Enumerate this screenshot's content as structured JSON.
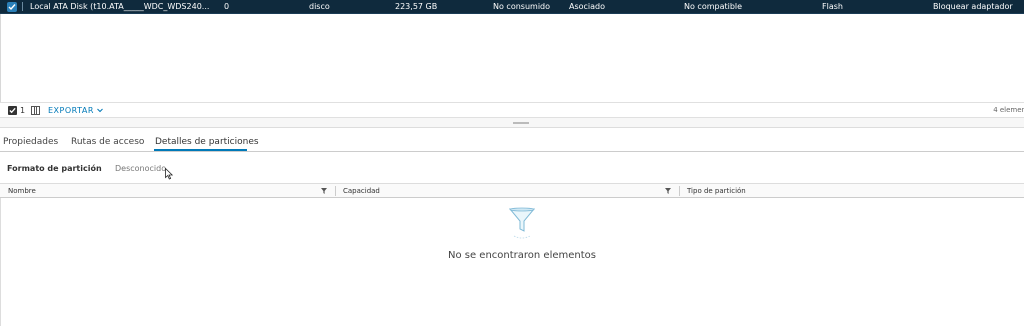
{
  "selected_row": {
    "name": "Local ATA Disk (t10.ATA_____WDC_WDS240...",
    "lun": "0",
    "type": "disco",
    "capacity": "223,57 GB",
    "datastore": "No consumido",
    "operational_state": "Asociado",
    "hardware_acceleration": "No compatible",
    "drive_type": "Flash",
    "action": "Bloquear adaptador"
  },
  "footer": {
    "selected_count": "1",
    "export_label": "EXPORTAR",
    "total": "4 elemen"
  },
  "tabs": [
    {
      "label": "Propiedades"
    },
    {
      "label": "Rutas de acceso"
    },
    {
      "label": "Detalles de particiones"
    }
  ],
  "partition": {
    "format_label": "Formato de partición",
    "format_value": "Desconocido"
  },
  "table": {
    "columns": [
      "Nombre",
      "Capacidad",
      "Tipo de partición"
    ],
    "empty_message": "No se encontraron elementos"
  },
  "colors": {
    "selected_row_bg": "#0f2a3d",
    "accent": "#0079b8"
  },
  "icons": {
    "checkbox": "checkmark-icon",
    "columns": "columns-icon",
    "filter": "filter-icon",
    "empty": "funnel-empty-icon",
    "cursor": "mouse-pointer-icon"
  }
}
